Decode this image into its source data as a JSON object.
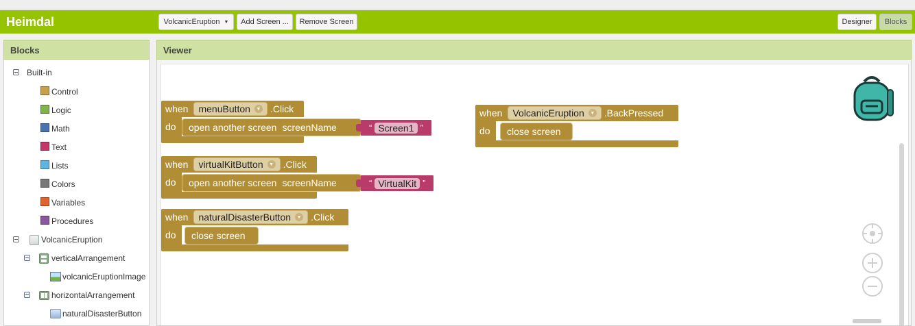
{
  "app": {
    "title": "Heimdal"
  },
  "toolbar": {
    "screen_select": "VolcanicEruption",
    "add_screen": "Add Screen ...",
    "remove_screen": "Remove Screen",
    "designer": "Designer",
    "blocks": "Blocks"
  },
  "blocks_panel": {
    "title": "Blocks",
    "builtin_label": "Built-in",
    "builtin_items": [
      {
        "label": "Control",
        "color": "#c8a048"
      },
      {
        "label": "Logic",
        "color": "#82b24c"
      },
      {
        "label": "Math",
        "color": "#4a73b0"
      },
      {
        "label": "Text",
        "color": "#c2366a"
      },
      {
        "label": "Lists",
        "color": "#5fb4e0"
      },
      {
        "label": "Colors",
        "color": "#777777"
      },
      {
        "label": "Variables",
        "color": "#e0652c"
      },
      {
        "label": "Procedures",
        "color": "#8c569c"
      }
    ],
    "components": {
      "screen": "VolcanicEruption",
      "vertical": "verticalArrangement",
      "image": "volcanicEruptionImage",
      "horizontal": "horizontalArrangement",
      "button": "naturalDisasterButton"
    }
  },
  "viewer": {
    "title": "Viewer",
    "blocks": [
      {
        "when": "when",
        "component": "menuButton",
        "event": ".Click",
        "do": "do",
        "action": "open another screen",
        "param": "screenName",
        "value": "Screen1"
      },
      {
        "when": "when",
        "component": "virtualKitButton",
        "event": ".Click",
        "do": "do",
        "action": "open another screen",
        "param": "screenName",
        "value": "VirtualKit"
      },
      {
        "when": "when",
        "component": "naturalDisasterButton",
        "event": ".Click",
        "do": "do",
        "action": "close screen"
      },
      {
        "when": "when",
        "component": "VolcanicEruption",
        "event": ".BackPressed",
        "do": "do",
        "action": "close screen"
      }
    ],
    "string_quote_open": "“",
    "string_quote_close": "”"
  },
  "colors": {
    "topbar": "#95c300",
    "panel_header": "#cfe1a3",
    "event_block": "#b18e35",
    "text_block": "#b83b6a"
  }
}
